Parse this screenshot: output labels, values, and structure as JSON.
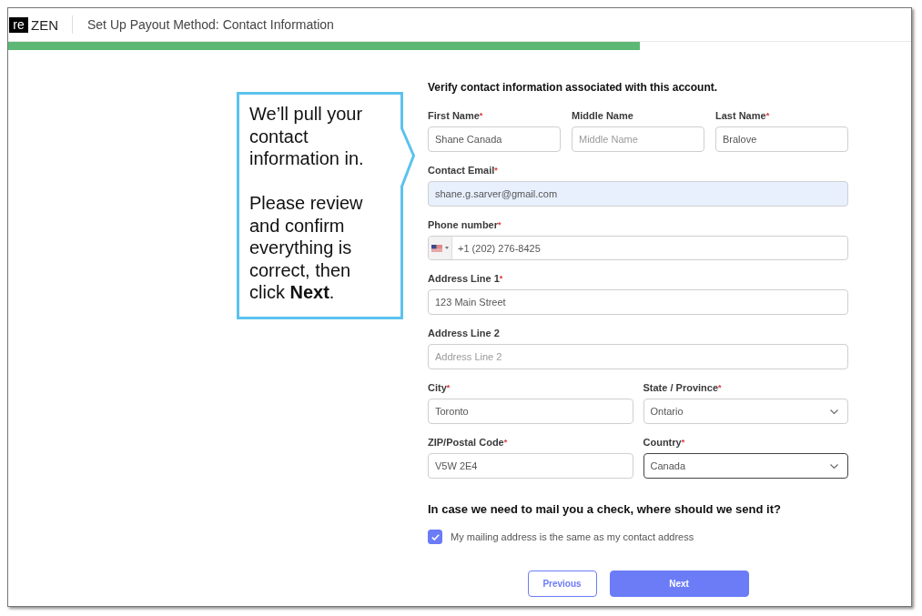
{
  "header": {
    "logo": {
      "badge": "re",
      "text": "ZEN"
    },
    "title": "Set Up Payout Method: Contact Information"
  },
  "progress": {
    "level": 0.7
  },
  "callout": {
    "paragraphs": [
      "We’ll pull your contact information in.",
      "Please review and confirm everything is correct, then click **Next**."
    ]
  },
  "form": {
    "heading": "Verify contact information associated with this account.",
    "rows": [
      {
        "fields": [
          {
            "kind": "text",
            "label": "First Name",
            "required_mark": "*",
            "value": "Shane Canada",
            "autofilled": false,
            "focused": false
          },
          {
            "kind": "text",
            "label": "Middle Name",
            "placeholder": "Middle Name",
            "autofilled": false,
            "focused": false
          },
          {
            "kind": "text",
            "label": "Last Name",
            "required_mark": "*",
            "value": "Bralove",
            "autofilled": false,
            "focused": false
          }
        ]
      },
      {
        "fields": [
          {
            "kind": "text",
            "label": "Contact Email",
            "required_mark": "*",
            "value": "shane.g.sarver@gmail.com",
            "autofilled": true,
            "focused": false
          }
        ]
      },
      {
        "fields": [
          {
            "kind": "phone",
            "label": "Phone number",
            "required_mark": "*",
            "value": "+1 (202) 276-8425",
            "autofilled": false,
            "focused": false
          }
        ]
      },
      {
        "fields": [
          {
            "kind": "text",
            "label": "Address Line 1",
            "required_mark": "*",
            "value": "123 Main Street",
            "autofilled": false,
            "focused": false
          }
        ]
      },
      {
        "fields": [
          {
            "kind": "text",
            "label": "Address Line 2",
            "placeholder": "Address Line 2",
            "autofilled": false,
            "focused": false
          }
        ]
      },
      {
        "fields": [
          {
            "kind": "text",
            "label": "City",
            "required_mark": "*",
            "value": "Toronto",
            "autofilled": false,
            "focused": false
          },
          {
            "kind": "select",
            "label": "State / Province",
            "required_mark": "*",
            "value": "Ontario",
            "autofilled": false,
            "focused": false
          }
        ]
      },
      {
        "fields": [
          {
            "kind": "text",
            "label": "ZIP/Postal Code",
            "required_mark": "*",
            "value": "V5W 2E4",
            "autofilled": false,
            "focused": false
          },
          {
            "kind": "select",
            "label": "Country",
            "required_mark": "*",
            "value": "Canada",
            "autofilled": false,
            "focused": true
          }
        ]
      }
    ]
  },
  "mailing": {
    "heading": "In case we need to mail you a check, where should we send it?",
    "option": {
      "label": "My mailing address is the same as my contact address",
      "checked": true
    }
  },
  "buttons": [
    {
      "label": "Previous",
      "kind": "secondary"
    },
    {
      "label": "Next",
      "kind": "primary"
    }
  ]
}
